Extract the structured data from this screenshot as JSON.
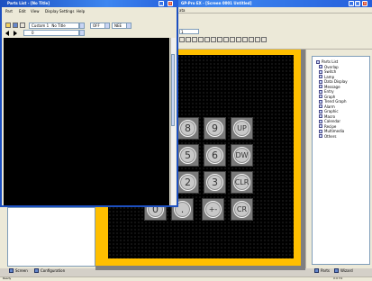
{
  "main_window": {
    "title": "GP-Pro EX - [Screen 0001 Untitled]",
    "menu_visible": "ata",
    "screen_number": "1"
  },
  "popup": {
    "title": "Parts List - [No Title]",
    "menu": [
      "Part",
      "Edit",
      "View",
      "Display Settings",
      "Help"
    ],
    "combo_1": "Custom 1",
    "combo_1_suffix": "No Title",
    "combo_2": "OFF",
    "combo_3": "NEE",
    "row2_value": "0"
  },
  "keypad": {
    "rows": [
      [
        "8",
        "9",
        "UP"
      ],
      [
        "5",
        "6",
        "DW"
      ],
      [
        "2",
        "3",
        "CLR"
      ],
      [
        "0",
        ".",
        "+-",
        "CR"
      ]
    ]
  },
  "tree": {
    "items": [
      {
        "label": "Parts List",
        "indent": 0
      },
      {
        "label": "Overlap",
        "indent": 1
      },
      {
        "label": "Switch",
        "indent": 1
      },
      {
        "label": "Lamp",
        "indent": 1
      },
      {
        "label": "Data Display",
        "indent": 1
      },
      {
        "label": "Message",
        "indent": 1
      },
      {
        "label": "Entry",
        "indent": 1
      },
      {
        "label": "Graph",
        "indent": 1
      },
      {
        "label": "Trend Graph",
        "indent": 1
      },
      {
        "label": "Alarm",
        "indent": 1
      },
      {
        "label": "Graphic",
        "indent": 1
      },
      {
        "label": "Macro",
        "indent": 1
      },
      {
        "label": "Calendar",
        "indent": 1
      },
      {
        "label": "Recipe",
        "indent": 1
      },
      {
        "label": "Multimedia",
        "indent": 1
      },
      {
        "label": "Others",
        "indent": 1
      }
    ]
  },
  "left_tabs": {
    "screen": "Screen",
    "configuration": "Configuration"
  },
  "right_tabs": {
    "parts": "Parts",
    "wizard": "Wizard"
  },
  "statusbar": {
    "text": "Ready",
    "coords": "X:0 Y:0"
  },
  "colors": {
    "titlebar": "#245edb",
    "canvas_frame": "#ffbf00",
    "canvas_bg": "#000000"
  },
  "icons": [
    "folder-icon",
    "save-icon",
    "print-icon",
    "window-icons"
  ]
}
